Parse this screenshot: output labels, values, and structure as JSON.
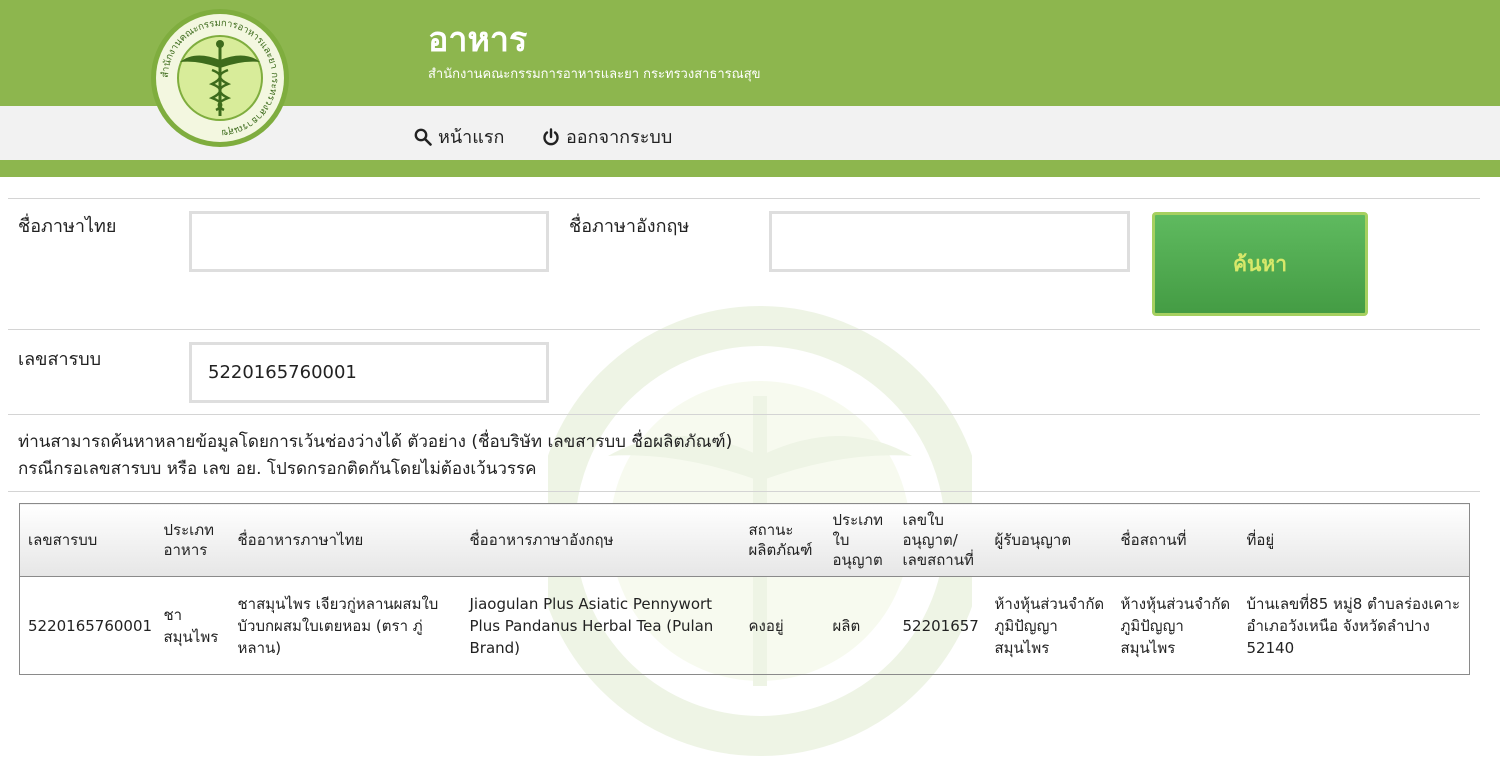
{
  "header": {
    "title": "อาหาร",
    "subtitle": "สำนักงานคณะกรรมการอาหารและยา กระทรวงสาธารณสุข",
    "logo_text": "สำนักงานคณะกรรมการอาหารและยา กระทรวงสาธารณสุข"
  },
  "nav": {
    "home_label": "หน้าแรก",
    "logout_label": "ออกจากระบบ"
  },
  "search": {
    "thai_name_label": "ชื่อภาษาไทย",
    "thai_name_value": "",
    "english_name_label": "ชื่อภาษาอังกฤษ",
    "english_name_value": "",
    "search_button_label": "ค้นหา",
    "reg_no_label": "เลขสารบบ",
    "reg_no_value": "5220165760001"
  },
  "hints": {
    "line1": "ท่านสามารถค้นหาหลายข้อมูลโดยการเว้นช่องว่างได้ ตัวอย่าง (ชื่อบริษัท เลขสารบบ ชื่อผลิตภัณฑ์)",
    "line2": "กรณีกรอเลขสารบบ หรือ เลข อย. โปรดกรอกติดกันโดยไม่ต้องเว้นวรรค"
  },
  "table": {
    "headers": [
      "เลขสารบบ",
      "ประเภทอาหาร",
      "ชื่ออาหารภาษาไทย",
      "ชื่ออาหารภาษาอังกฤษ",
      "สถานะผลิตภัณฑ์",
      "ประเภทใบอนุญาต",
      "เลขใบอนุญาต/เลขสถานที่",
      "ผู้รับอนุญาต",
      "ชื่อสถานที่",
      "ที่อยู่"
    ],
    "rows": [
      [
        "5220165760001",
        "ชาสมุนไพร",
        "ชาสมุนไพร เจียวกู่หลานผสมใบบัวบกผสมใบเตยหอม (ตรา ภู่หลาน)",
        "Jiaogulan Plus Asiatic Pennywort Plus Pandanus Herbal Tea (Pulan Brand)",
        "คงอยู่",
        "ผลิต",
        "52201657",
        "ห้างหุ้นส่วนจำกัด ภูมิปัญญาสมุนไพร",
        "ห้างหุ้นส่วนจำกัด ภูมิปัญญาสมุนไพร",
        "บ้านเลขที่85 หมู่8 ตำบลร่องเคาะ อำเภอวังเหนือ จังหวัดลำปาง 52140"
      ]
    ]
  },
  "colors": {
    "header_green": "#8db64e",
    "button_green": "#4fa84f",
    "button_text": "#d7e86a"
  }
}
